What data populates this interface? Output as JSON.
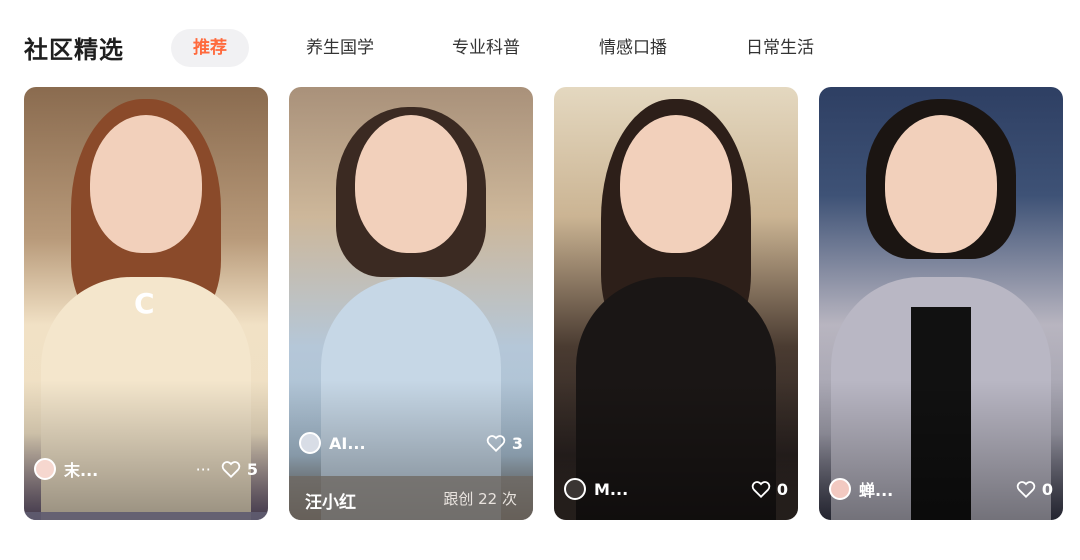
{
  "header": {
    "title": "社区精选",
    "tabs": [
      {
        "label": "推荐",
        "active": true
      },
      {
        "label": "养生国学"
      },
      {
        "label": "专业科普"
      },
      {
        "label": "情感口播"
      },
      {
        "label": "日常生活"
      }
    ]
  },
  "cards": [
    {
      "author": "末...",
      "more": "···",
      "likes": "5",
      "loading": "C",
      "footer_name": "",
      "footer_count": ""
    },
    {
      "author": "AI...",
      "likes": "3",
      "footer_name": "汪小红",
      "footer_count": "跟创 22 次"
    },
    {
      "author": "M...",
      "likes": "0"
    },
    {
      "author": "蝉...",
      "likes": "0"
    }
  ],
  "colors": {
    "accent": "#ff6a3d",
    "tab_active_bg": "#f1f1f3"
  }
}
